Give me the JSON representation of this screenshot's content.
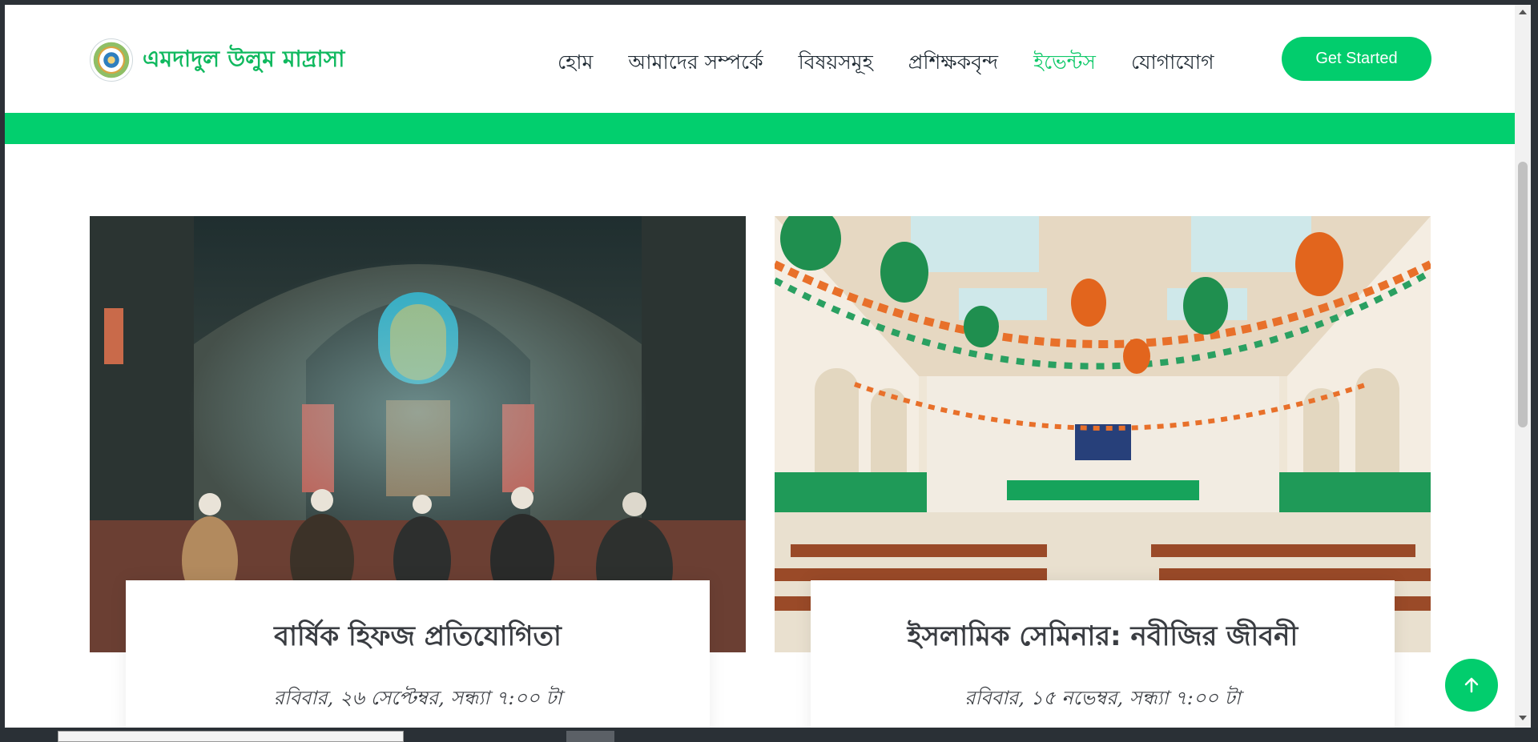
{
  "header": {
    "brand_name": "এমদাদুল উলুম মাদ্রাসা",
    "logo_icon": "madrasa-seal-logo",
    "nav": [
      {
        "label": "হোম",
        "active": false
      },
      {
        "label": "আমাদের সম্পর্কে",
        "active": false
      },
      {
        "label": "বিষয়সমূহ",
        "active": false
      },
      {
        "label": "প্রশিক্ষকবৃন্দ",
        "active": false
      },
      {
        "label": "ইভেন্টস",
        "active": true
      },
      {
        "label": "যোগাযোগ",
        "active": false
      }
    ],
    "cta_label": "Get Started"
  },
  "colors": {
    "accent": "#02cd6d",
    "brand_text": "#10b95f",
    "nav_text": "#1f2a33",
    "nav_active": "#10c96a"
  },
  "events": [
    {
      "title": "বার্ষিক হিফজ প্রতিযোগিতা",
      "date": "রবিবার, ২৬ সেপ্টেম্বর, সন্ধ্যা ৭:০০ টা",
      "image": "mosque-interior-prayer-scene"
    },
    {
      "title": "ইসলামিক সেমিনার: নবীজির জীবনী",
      "date": "রবিবার, ১৫ নভেম্বর, সন্ধ্যা ৭:০০ টা",
      "image": "decorated-hall-balloons-bunting"
    }
  ],
  "scroll_top_icon": "arrow-up-icon"
}
